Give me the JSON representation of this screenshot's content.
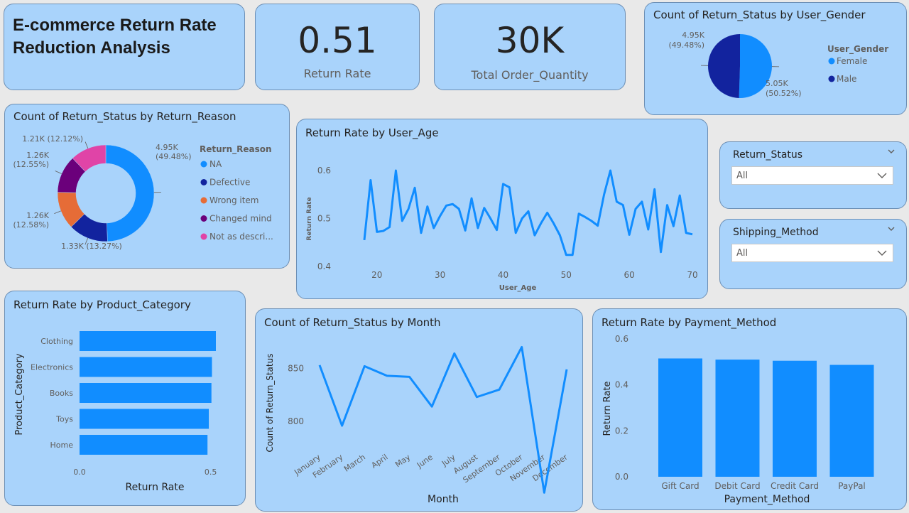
{
  "colors": {
    "background": "#e9e9e9",
    "card": "#a9d3fb",
    "card_border": "#6c8fb5",
    "series_blue": "#118dff",
    "dark_blue": "#12239e",
    "orange": "#e66c37",
    "purple": "#6b007b",
    "pink": "#e044a7"
  },
  "title": {
    "line1": "E-commerce Return Rate",
    "line2": "Reduction Analysis"
  },
  "kpis": [
    {
      "value": "0.51",
      "label": "Return Rate"
    },
    {
      "value": "30K",
      "label": "Total Order_Quantity"
    }
  ],
  "slicers": {
    "return_status": {
      "title": "Return_Status",
      "value": "All"
    },
    "shipping_method": {
      "title": "Shipping_Method",
      "value": "All"
    }
  },
  "chart_data": [
    {
      "type": "pie",
      "title": "Count of Return_Status by User_Gender",
      "legend_title": "User_Gender",
      "legend_position": "right",
      "categories": [
        "Female",
        "Male"
      ],
      "values": [
        5050,
        4950
      ],
      "labels": [
        "5.05K",
        "4.95K"
      ],
      "percent_labels": [
        "(50.52%)",
        "(49.48%)"
      ],
      "colors": [
        "#118dff",
        "#12239e"
      ]
    },
    {
      "type": "pie",
      "subtype": "donut",
      "title": "Count of Return_Status by Return_Reason",
      "legend_title": "Return_Reason",
      "legend_position": "right",
      "categories": [
        "NA",
        "Defective",
        "Wrong item",
        "Changed mind",
        "Not as descri..."
      ],
      "values": [
        4950,
        1330,
        1260,
        1260,
        1210
      ],
      "labels": [
        "4.95K",
        "1.33K",
        "1.26K",
        "1.26K",
        "1.21K"
      ],
      "percent_labels": [
        "(49.48%)",
        "(13.27%)",
        "(12.58%)",
        "(12.55%)",
        "(12.12%)"
      ],
      "colors": [
        "#118dff",
        "#12239e",
        "#e66c37",
        "#6b007b",
        "#e044a7"
      ]
    },
    {
      "type": "line",
      "title": "Return Rate by User_Age",
      "xlabel": "User_Age",
      "ylabel": "Return Rate",
      "xlim": [
        18,
        70
      ],
      "ylim": [
        0.4,
        0.6
      ],
      "x_ticks": [
        20,
        30,
        40,
        50,
        60,
        70
      ],
      "y_ticks": [
        0.4,
        0.5,
        0.6
      ],
      "y_tick_labels": [
        "0.4",
        "0.5",
        "0.6"
      ],
      "grid": false,
      "x": [
        18,
        19,
        20,
        21,
        22,
        23,
        24,
        25,
        26,
        27,
        28,
        29,
        30,
        31,
        32,
        33,
        34,
        35,
        36,
        37,
        38,
        39,
        40,
        41,
        42,
        43,
        44,
        45,
        46,
        47,
        48,
        49,
        50,
        51,
        52,
        53,
        54,
        55,
        56,
        57,
        58,
        59,
        60,
        61,
        62,
        63,
        64,
        65,
        66,
        67,
        68,
        69,
        70
      ],
      "y": [
        0.455,
        0.58,
        0.472,
        0.474,
        0.482,
        0.6,
        0.495,
        0.52,
        0.564,
        0.47,
        0.525,
        0.48,
        0.505,
        0.527,
        0.53,
        0.52,
        0.475,
        0.542,
        0.48,
        0.522,
        0.5,
        0.476,
        0.572,
        0.565,
        0.47,
        0.5,
        0.515,
        0.465,
        0.49,
        0.512,
        0.49,
        0.465,
        0.424,
        0.424,
        0.51,
        0.503,
        0.495,
        0.485,
        0.55,
        0.6,
        0.535,
        0.528,
        0.466,
        0.52,
        0.535,
        0.477,
        0.561,
        0.43,
        0.528,
        0.484,
        0.548,
        0.47,
        0.467
      ]
    },
    {
      "type": "bar",
      "orientation": "horizontal",
      "title": "Return Rate by Product_Category",
      "xlabel": "Return Rate",
      "ylabel": "Product_Category",
      "categories": [
        "Clothing",
        "Electronics",
        "Books",
        "Toys",
        "Home"
      ],
      "values": [
        0.52,
        0.505,
        0.503,
        0.493,
        0.488
      ],
      "xlim": [
        0,
        0.55
      ],
      "x_ticks": [
        0.0,
        0.5
      ],
      "x_tick_labels": [
        "0.0",
        "0.5"
      ],
      "grid": false
    },
    {
      "type": "line",
      "title": "Count of Return_Status by Month",
      "xlabel": "Month",
      "ylabel": "Count of Return_Status",
      "categories": [
        "January",
        "February",
        "March",
        "April",
        "May",
        "June",
        "July",
        "August",
        "September",
        "October",
        "November",
        "December"
      ],
      "values": [
        853,
        796,
        852,
        843,
        842,
        814,
        864,
        823,
        830,
        870,
        733,
        849
      ],
      "ylim": [
        770,
        875
      ],
      "y_ticks": [
        800,
        850
      ],
      "y_tick_labels": [
        "800",
        "850"
      ],
      "grid": false
    },
    {
      "type": "bar",
      "title": "Return Rate by Payment_Method",
      "xlabel": "Payment_Method",
      "ylabel": "Return Rate",
      "categories": [
        "Gift Card",
        "Debit Card",
        "Credit Card",
        "PayPal"
      ],
      "values": [
        0.515,
        0.51,
        0.505,
        0.487
      ],
      "ylim": [
        0,
        0.6
      ],
      "y_ticks": [
        0.0,
        0.2,
        0.4,
        0.6
      ],
      "y_tick_labels": [
        "0.0",
        "0.2",
        "0.4",
        "0.6"
      ],
      "grid": false
    }
  ]
}
